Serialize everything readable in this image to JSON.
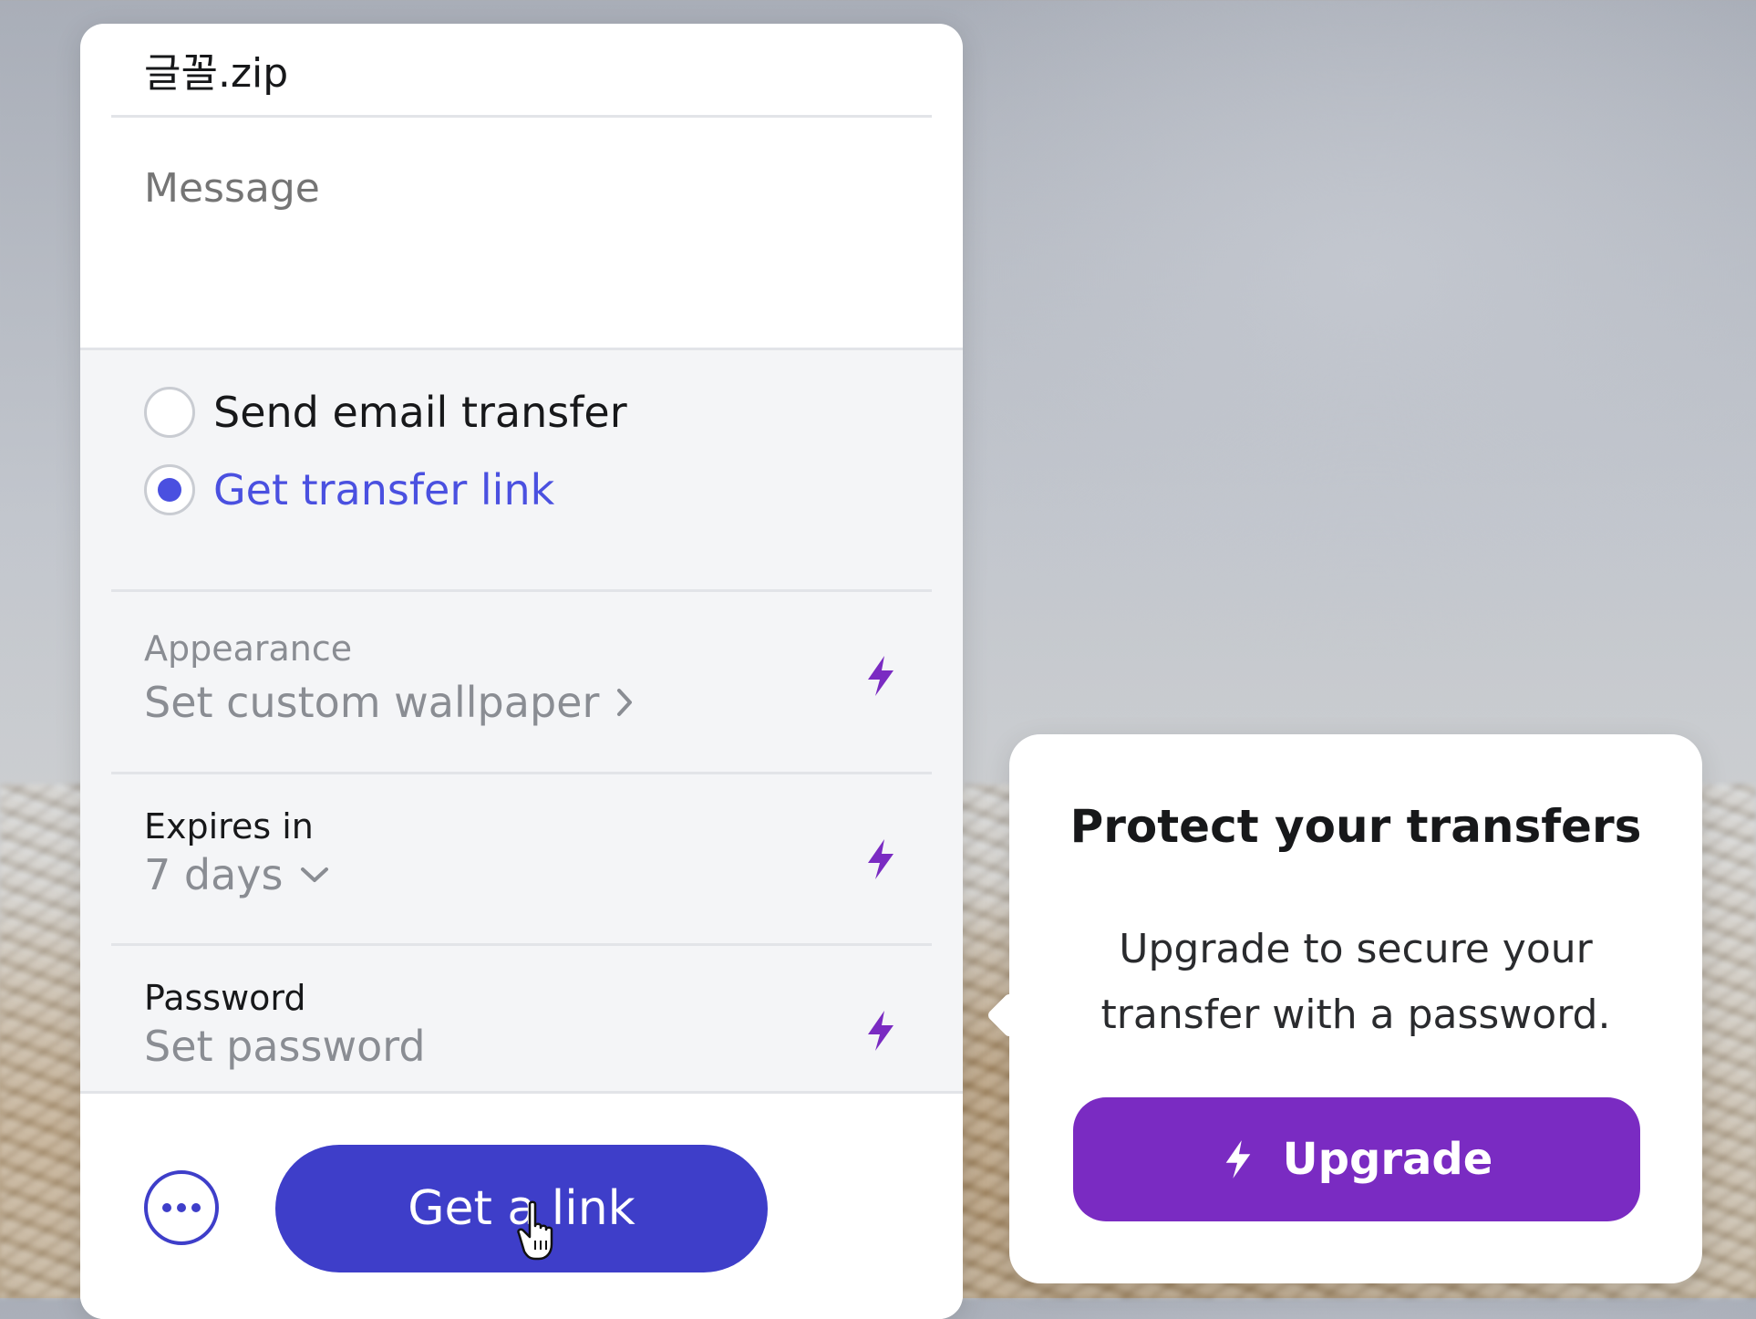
{
  "transfer": {
    "file_name": "글꼴.zip",
    "message_placeholder": "Message"
  },
  "mode": {
    "options": [
      {
        "label": "Send email transfer",
        "selected": false
      },
      {
        "label": "Get transfer link",
        "selected": true
      }
    ]
  },
  "settings": {
    "appearance": {
      "label": "Appearance",
      "value": "Set custom wallpaper"
    },
    "expires": {
      "label": "Expires in",
      "value": "7 days"
    },
    "password": {
      "label": "Password",
      "value": "Set password"
    }
  },
  "footer": {
    "primary_label": "Get a link"
  },
  "popover": {
    "title": "Protect your transfers",
    "body": "Upgrade to secure your transfer with a password.",
    "button_label": "Upgrade"
  },
  "colors": {
    "primary": "#3e3ec9",
    "link_blue": "#4a50e0",
    "upgrade_purple": "#7a2bc2",
    "bolt_purple": "#7a2bc2"
  },
  "icons": [
    "more-icon",
    "bolt-icon",
    "chevron-right-icon",
    "chevron-down-icon",
    "hand-cursor-icon"
  ]
}
